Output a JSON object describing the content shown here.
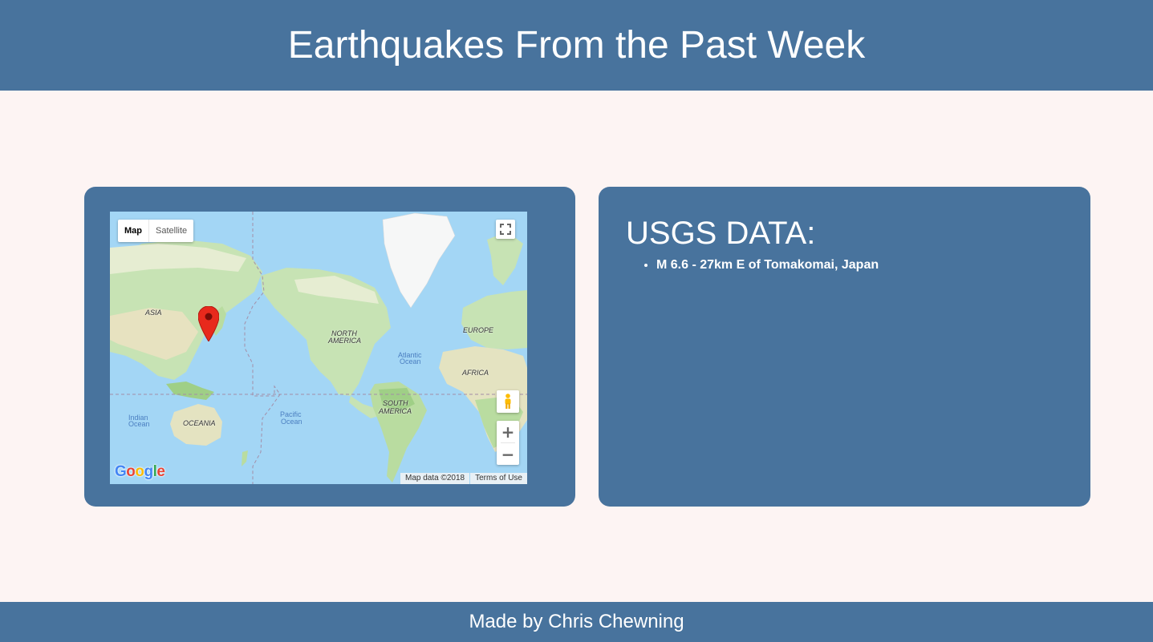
{
  "header": {
    "title": "Earthquakes From the Past Week"
  },
  "map": {
    "type_controls": {
      "map_label": "Map",
      "satellite_label": "Satellite",
      "selected": "Map"
    },
    "labels": {
      "asia": "ASIA",
      "north_america_1": "NORTH",
      "north_america_2": "AMERICA",
      "europe": "EUROPE",
      "africa": "AFRICA",
      "south_america_1": "SOUTH",
      "south_america_2": "AMERICA",
      "oceania": "OCEANIA",
      "atlantic_1": "Atlantic",
      "atlantic_2": "Ocean",
      "pacific_1": "Pacific",
      "pacific_2": "Ocean",
      "indian_1": "Indian",
      "indian_2": "Ocean"
    },
    "attribution": {
      "map_data": "Map data ©2018",
      "terms": "Terms of Use"
    },
    "logo": {
      "g": "G",
      "o1": "o",
      "o2": "o",
      "g2": "g",
      "l": "l",
      "e": "e"
    },
    "zoom": {
      "in": "+",
      "out": "−"
    },
    "marker_color": "#e8291c"
  },
  "usgs": {
    "title": "USGS DATA:",
    "items": [
      "M 6.6 - 27km E of Tomakomai, Japan"
    ]
  },
  "footer": {
    "text": "Made by Chris Chewning"
  },
  "colors": {
    "primary": "#48739d",
    "background": "#fdf4f3",
    "water": "#a3d6f5",
    "land": "#c7e3b4"
  }
}
